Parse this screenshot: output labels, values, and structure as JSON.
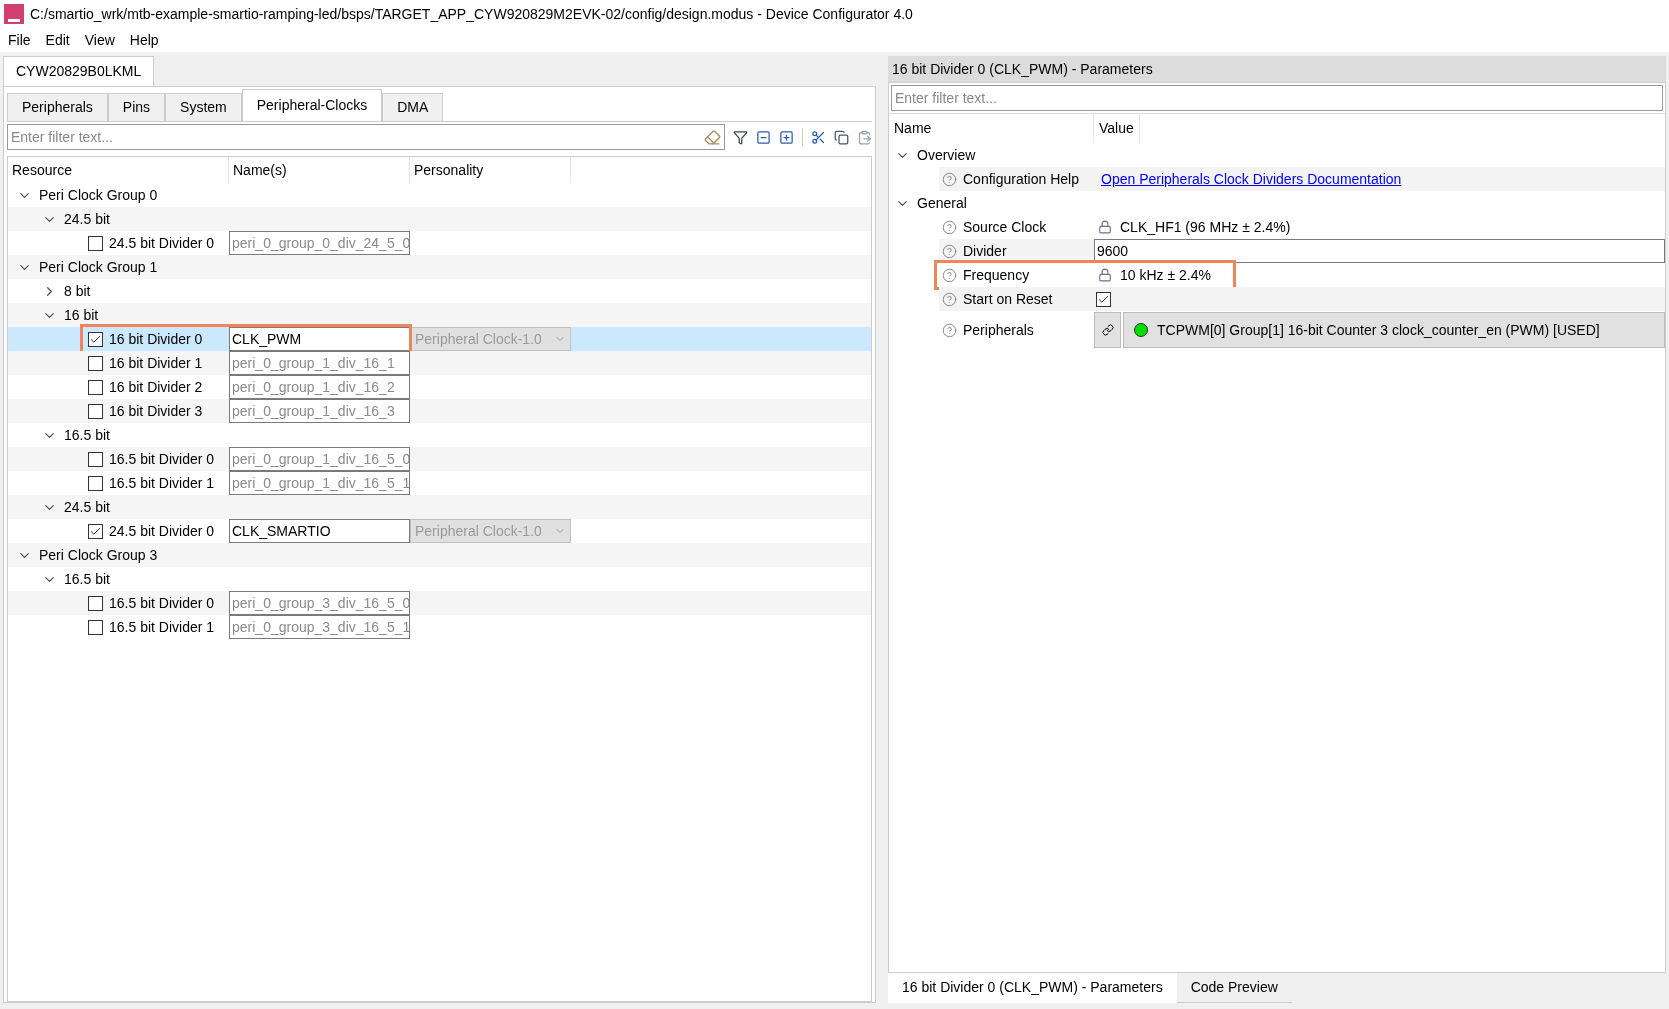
{
  "window": {
    "title": "C:/smartio_wrk/mtb-example-smartio-ramping-led/bsps/TARGET_APP_CYW920829M2EVK-02/config/design.modus - Device Configurator 4.0"
  },
  "menu": [
    "File",
    "Edit",
    "View",
    "Help"
  ],
  "device_tab": "CYW20829B0LKML",
  "tabs": [
    {
      "label": "Peripherals",
      "selected": false
    },
    {
      "label": "Pins",
      "selected": false
    },
    {
      "label": "System",
      "selected": false
    },
    {
      "label": "Peripheral-Clocks",
      "selected": true
    },
    {
      "label": "DMA",
      "selected": false
    }
  ],
  "filter": {
    "placeholder": "Enter filter text..."
  },
  "columns": [
    "Resource",
    "Name(s)",
    "Personality"
  ],
  "tree": [
    {
      "kind": "group",
      "label": "Peri Clock Group 0",
      "expanded": true,
      "children": [
        {
          "kind": "group",
          "label": "24.5 bit",
          "expanded": true,
          "children": [
            {
              "kind": "divider",
              "label": "24.5 bit Divider 0",
              "checked": false,
              "name": "peri_0_group_0_div_24_5_0",
              "selected": false,
              "highlighted": false
            }
          ]
        }
      ]
    },
    {
      "kind": "group",
      "label": "Peri Clock Group 1",
      "expanded": true,
      "children": [
        {
          "kind": "group",
          "label": "8 bit",
          "expanded": false
        },
        {
          "kind": "group",
          "label": "16 bit",
          "expanded": true,
          "children": [
            {
              "kind": "divider",
              "label": "16 bit Divider 0",
              "checked": true,
              "name": "CLK_PWM",
              "personality": "Peripheral Clock-1.0",
              "selected": true,
              "highlighted": true
            },
            {
              "kind": "divider",
              "label": "16 bit Divider 1",
              "checked": false,
              "name": "peri_0_group_1_div_16_1",
              "selected": false,
              "highlighted": false
            },
            {
              "kind": "divider",
              "label": "16 bit Divider 2",
              "checked": false,
              "name": "peri_0_group_1_div_16_2",
              "selected": false,
              "highlighted": false
            },
            {
              "kind": "divider",
              "label": "16 bit Divider 3",
              "checked": false,
              "name": "peri_0_group_1_div_16_3",
              "selected": false,
              "highlighted": false
            }
          ]
        },
        {
          "kind": "group",
          "label": "16.5 bit",
          "expanded": true,
          "children": [
            {
              "kind": "divider",
              "label": "16.5 bit Divider 0",
              "checked": false,
              "name": "peri_0_group_1_div_16_5_0",
              "selected": false,
              "highlighted": false
            },
            {
              "kind": "divider",
              "label": "16.5 bit Divider 1",
              "checked": false,
              "name": "peri_0_group_1_div_16_5_1",
              "selected": false,
              "highlighted": false
            }
          ]
        },
        {
          "kind": "group",
          "label": "24.5 bit",
          "expanded": true,
          "children": [
            {
              "kind": "divider",
              "label": "24.5 bit Divider 0",
              "checked": true,
              "name": "CLK_SMARTIO",
              "personality": "Peripheral Clock-1.0",
              "selected": false,
              "highlighted": false
            }
          ]
        }
      ]
    },
    {
      "kind": "group",
      "label": "Peri Clock Group 3",
      "expanded": true,
      "children": [
        {
          "kind": "group",
          "label": "16.5 bit",
          "expanded": true,
          "children": [
            {
              "kind": "divider",
              "label": "16.5 bit Divider 0",
              "checked": false,
              "name": "peri_0_group_3_div_16_5_0",
              "selected": false,
              "highlighted": false
            },
            {
              "kind": "divider",
              "label": "16.5 bit Divider 1",
              "checked": false,
              "name": "peri_0_group_3_div_16_5_1",
              "selected": false,
              "highlighted": false
            }
          ]
        }
      ]
    }
  ],
  "params_panel": {
    "title": "16 bit Divider 0 (CLK_PWM) - Parameters",
    "filter_placeholder": "Enter filter text...",
    "columns": [
      "Name",
      "Value"
    ],
    "sections": [
      {
        "label": "Overview",
        "expanded": true,
        "params": [
          {
            "kind": "link",
            "name": "Configuration Help",
            "value": "Open Peripherals Clock Dividers Documentation",
            "highlighted": false
          }
        ]
      },
      {
        "label": "General",
        "expanded": true,
        "params": [
          {
            "kind": "locked",
            "name": "Source Clock",
            "value": "CLK_HF1 (96 MHz ± 2.4%)",
            "highlighted": false
          },
          {
            "kind": "input",
            "name": "Divider",
            "value": "9600",
            "highlighted": false
          },
          {
            "kind": "locked",
            "name": "Frequency",
            "value": "10 kHz ± 2.4%",
            "highlighted": true
          },
          {
            "kind": "checkbox",
            "name": "Start on Reset",
            "checked": true,
            "highlighted": false
          },
          {
            "kind": "peripheral",
            "name": "Peripherals",
            "value": "TCPWM[0] Group[1] 16-bit Counter 3 clock_counter_en (PWM) [USED]",
            "highlighted": false
          }
        ]
      }
    ]
  },
  "bottom_tabs": [
    {
      "label": "16 bit Divider 0 (CLK_PWM) - Parameters",
      "selected": true
    },
    {
      "label": "Code Preview",
      "selected": false
    }
  ]
}
